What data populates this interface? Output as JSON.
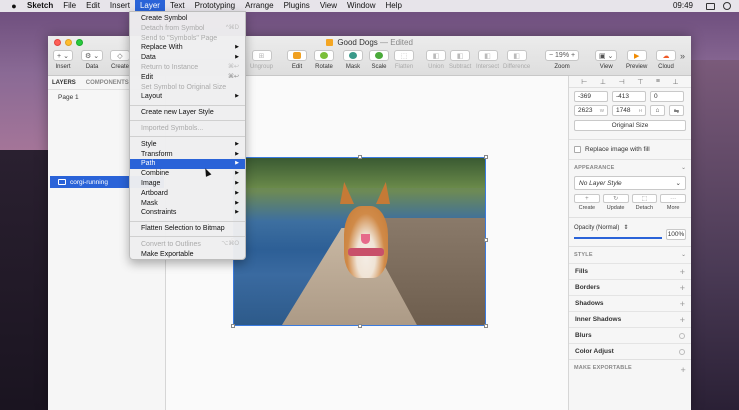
{
  "menubar": {
    "app": "Sketch",
    "items": [
      "File",
      "Edit",
      "Insert",
      "Layer",
      "Text",
      "Prototyping",
      "Arrange",
      "Plugins",
      "View",
      "Window",
      "Help"
    ],
    "active": "Layer",
    "time": "09:49"
  },
  "window": {
    "title": "Good Dogs",
    "status": "— Edited"
  },
  "toolbar": {
    "left": [
      {
        "label": "Insert",
        "glyph": "+ ⌄"
      },
      {
        "label": "Data",
        "glyph": "⚙ ⌄"
      },
      {
        "label": "Create",
        "glyph": "◇"
      }
    ],
    "middle": [
      {
        "label": "Ungroup",
        "glyph": "⊞",
        "dim": true
      },
      {
        "label": "Edit",
        "glyph": "✎",
        "dim": false
      },
      {
        "label": "Rotate",
        "glyph": "↻",
        "dim": false
      },
      {
        "label": "Mask",
        "glyph": "●",
        "dim": false
      },
      {
        "label": "Scale",
        "glyph": "●",
        "dim": false
      },
      {
        "label": "Flatten",
        "glyph": "⬚",
        "dim": true
      },
      {
        "label": "Union",
        "glyph": "◧",
        "dim": true
      },
      {
        "label": "Subtract",
        "glyph": "◧",
        "dim": true
      },
      {
        "label": "Intersect",
        "glyph": "◧",
        "dim": true
      },
      {
        "label": "Difference",
        "glyph": "◧",
        "dim": true
      }
    ],
    "right": [
      {
        "label": "Zoom",
        "glyph": "−  19%  +"
      },
      {
        "label": "View",
        "glyph": "▣ ⌄"
      },
      {
        "label": "Preview",
        "glyph": "▶"
      },
      {
        "label": "Cloud",
        "glyph": "☁"
      }
    ],
    "overflow": "»"
  },
  "left_panel": {
    "tabs": [
      "LAYERS",
      "COMPONENTS"
    ],
    "page": "Page 1",
    "layer": "corgi-running"
  },
  "layer_menu": {
    "items": [
      {
        "label": "Create Symbol",
        "shortcut": "",
        "dim": false,
        "sub": false,
        "hl": false
      },
      {
        "label": "Detach from Symbol",
        "shortcut": "^⌘D",
        "dim": true,
        "sub": false,
        "hl": false
      },
      {
        "label": "Send to \"Symbols\" Page",
        "shortcut": "",
        "dim": true,
        "sub": false,
        "hl": false
      },
      {
        "label": "Replace With",
        "shortcut": "",
        "dim": false,
        "sub": true,
        "hl": false
      },
      {
        "label": "Data",
        "shortcut": "",
        "dim": false,
        "sub": true,
        "hl": false
      },
      {
        "label": "Return to Instance",
        "shortcut": "⌘↩",
        "dim": true,
        "sub": false,
        "hl": false
      },
      {
        "label": "Edit",
        "shortcut": "⌘↩",
        "dim": false,
        "sub": false,
        "hl": false
      },
      {
        "label": "Set Symbol to Original Size",
        "shortcut": "",
        "dim": true,
        "sub": false,
        "hl": false
      },
      {
        "label": "Layout",
        "shortcut": "",
        "dim": false,
        "sub": true,
        "hl": false
      },
      {
        "sep": true
      },
      {
        "label": "Create new Layer Style",
        "shortcut": "",
        "dim": false,
        "sub": false,
        "hl": false
      },
      {
        "sep": true
      },
      {
        "label": "Imported Symbols...",
        "shortcut": "",
        "dim": true,
        "sub": false,
        "hl": false
      },
      {
        "sep": true
      },
      {
        "label": "Style",
        "shortcut": "",
        "dim": false,
        "sub": true,
        "hl": false
      },
      {
        "label": "Transform",
        "shortcut": "",
        "dim": false,
        "sub": true,
        "hl": false
      },
      {
        "label": "Path",
        "shortcut": "",
        "dim": false,
        "sub": true,
        "hl": true
      },
      {
        "label": "Combine",
        "shortcut": "",
        "dim": false,
        "sub": true,
        "hl": false
      },
      {
        "label": "Image",
        "shortcut": "",
        "dim": false,
        "sub": true,
        "hl": false
      },
      {
        "label": "Artboard",
        "shortcut": "",
        "dim": false,
        "sub": true,
        "hl": false
      },
      {
        "label": "Mask",
        "shortcut": "",
        "dim": false,
        "sub": true,
        "hl": false
      },
      {
        "label": "Constraints",
        "shortcut": "",
        "dim": false,
        "sub": true,
        "hl": false
      },
      {
        "sep": true
      },
      {
        "label": "Flatten Selection to Bitmap",
        "shortcut": "",
        "dim": false,
        "sub": false,
        "hl": false
      },
      {
        "sep": true
      },
      {
        "label": "Convert to Outlines",
        "shortcut": "⌥⌘O",
        "dim": true,
        "sub": false,
        "hl": false
      },
      {
        "label": "Make Exportable",
        "shortcut": "",
        "dim": false,
        "sub": false,
        "hl": false
      }
    ]
  },
  "inspector": {
    "x": "-369",
    "y": "-413",
    "rotation": "0",
    "w": "2623",
    "w_unit": "W",
    "h": "1748",
    "h_unit": "H",
    "original_size": "Original Size",
    "replace_fill": "Replace image with fill",
    "appearance": "APPEARANCE",
    "layer_style": "No Layer Style",
    "style_buttons": [
      "Create",
      "Update",
      "Detach",
      "More"
    ],
    "opacity_label": "Opacity (Normal)",
    "opacity_value": "100%",
    "opacity_fraction": 1.0,
    "style_section": "STYLE",
    "properties": [
      {
        "label": "Fills",
        "control": "plus"
      },
      {
        "label": "Borders",
        "control": "plus"
      },
      {
        "label": "Shadows",
        "control": "plus"
      },
      {
        "label": "Inner Shadows",
        "control": "plus"
      },
      {
        "label": "Blurs",
        "control": "ring"
      },
      {
        "label": "Color Adjust",
        "control": "ring"
      }
    ],
    "export_section": "MAKE EXPORTABLE"
  },
  "colors": {
    "accent": "#2a63d8",
    "selection": "#3a7be0"
  }
}
